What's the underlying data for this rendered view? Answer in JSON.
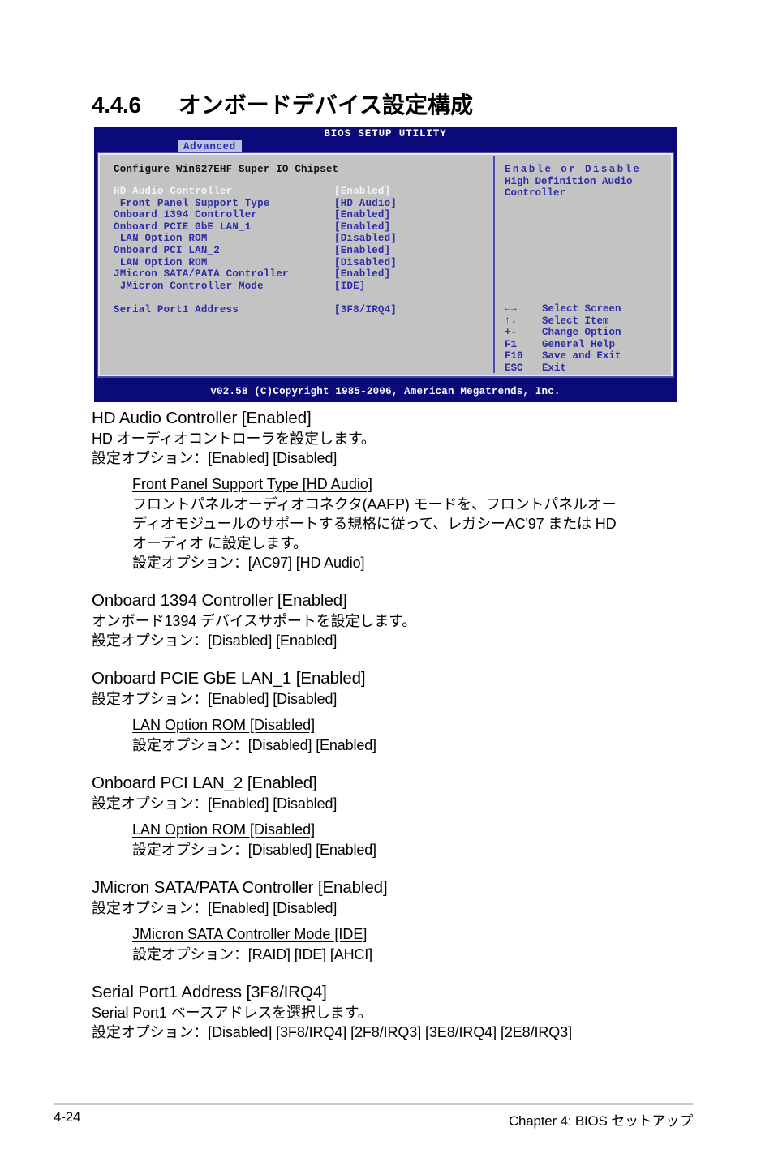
{
  "section": {
    "number": "4.4.6",
    "title": "オンボードデバイス設定構成"
  },
  "bios": {
    "title": "BIOS SETUP UTILITY",
    "tab": "Advanced",
    "config_header": "Configure Win627EHF Super IO Chipset",
    "items": [
      {
        "label": "HD Audio Controller",
        "value": "[Enabled]",
        "selected": true,
        "indent": 0
      },
      {
        "label": " Front Panel Support Type",
        "value": "[HD Audio]",
        "selected": false,
        "indent": 1
      },
      {
        "label": "Onboard 1394 Controller",
        "value": "[Enabled]",
        "selected": false,
        "indent": 0
      },
      {
        "label": "Onboard PCIE GbE LAN_1",
        "value": "[Enabled]",
        "selected": false,
        "indent": 0
      },
      {
        "label": " LAN Option ROM",
        "value": "[Disabled]",
        "selected": false,
        "indent": 1
      },
      {
        "label": "Onboard PCI LAN_2",
        "value": "[Enabled]",
        "selected": false,
        "indent": 0
      },
      {
        "label": " LAN Option ROM",
        "value": "[Disabled]",
        "selected": false,
        "indent": 1
      },
      {
        "label": "JMicron SATA/PATA Controller",
        "value": "[Enabled]",
        "selected": false,
        "indent": 0
      },
      {
        "label": " JMicron Controller Mode",
        "value": "[IDE]",
        "selected": false,
        "indent": 1
      },
      {
        "label": "",
        "value": "",
        "selected": false,
        "indent": 0
      },
      {
        "label": "Serial Port1 Address",
        "value": "[3F8/IRQ4]",
        "selected": false,
        "indent": 0
      }
    ],
    "help": [
      "Enable or Disable",
      "High Definition Audio",
      "Controller"
    ],
    "keys": [
      {
        "key": "←→",
        "desc": "Select Screen",
        "icon": "left-right-arrow-icon"
      },
      {
        "key": "↑↓",
        "desc": "Select Item",
        "icon": "up-down-arrow-icon"
      },
      {
        "key": "+-",
        "desc": "Change Option",
        "icon": ""
      },
      {
        "key": "F1",
        "desc": "General Help",
        "icon": ""
      },
      {
        "key": "F10",
        "desc": "Save and Exit",
        "icon": ""
      },
      {
        "key": "ESC",
        "desc": "Exit",
        "icon": ""
      }
    ],
    "copyright": "v02.58 (C)Copyright 1985-2006, American Megatrends, Inc.",
    "colors": {
      "header_bg": "#0a0a78",
      "panel_bg": "#c3c3c3",
      "text_blue": "#2d2da8",
      "tab_bg": "#b9c2de"
    }
  },
  "body": {
    "b1": {
      "title": "HD Audio Controller [Enabled]",
      "desc": "HD オーディオコントローラを設定します。",
      "options": "設定オプション：[Enabled] [Disabled]",
      "sub": {
        "title": "Front Panel Support Type [HD Audio]",
        "desc": "フロントパネルオーディオコネクタ(AAFP) モードを、フロントパネルオーディオモジュールのサポートする規格に従って、レガシーAC'97 または HD オーディオ に設定します。",
        "options": "設定オプション：[AC97] [HD Audio]"
      }
    },
    "b2": {
      "title": "Onboard 1394 Controller [Enabled]",
      "desc": "オンボード1394 デバイスサポートを設定します。",
      "options": "設定オプション：[Disabled] [Enabled]"
    },
    "b3": {
      "title": "Onboard PCIE GbE LAN_1 [Enabled]",
      "options": "設定オプション：[Enabled] [Disabled]",
      "sub": {
        "title": "LAN Option ROM [Disabled]",
        "options": "設定オプション：[Disabled] [Enabled]"
      }
    },
    "b4": {
      "title": "Onboard PCI LAN_2 [Enabled]",
      "options": "設定オプション：[Enabled] [Disabled]",
      "sub": {
        "title": "LAN Option ROM [Disabled]",
        "options": "設定オプション：[Disabled] [Enabled]"
      }
    },
    "b5": {
      "title": "JMicron SATA/PATA Controller [Enabled]",
      "options": "設定オプション：[Enabled] [Disabled]",
      "sub": {
        "title": "JMicron SATA Controller Mode [IDE]",
        "options": "設定オプション：[RAID] [IDE] [AHCI]"
      }
    },
    "b6": {
      "title": "Serial Port1 Address [3F8/IRQ4]",
      "desc": "Serial Port1 ベースアドレスを選択します。",
      "options": "設定オプション：[Disabled] [3F8/IRQ4] [2F8/IRQ3] [3E8/IRQ4] [2E8/IRQ3]"
    }
  },
  "footer": {
    "page": "4-24",
    "chapter": "Chapter 4: BIOS セットアップ"
  }
}
